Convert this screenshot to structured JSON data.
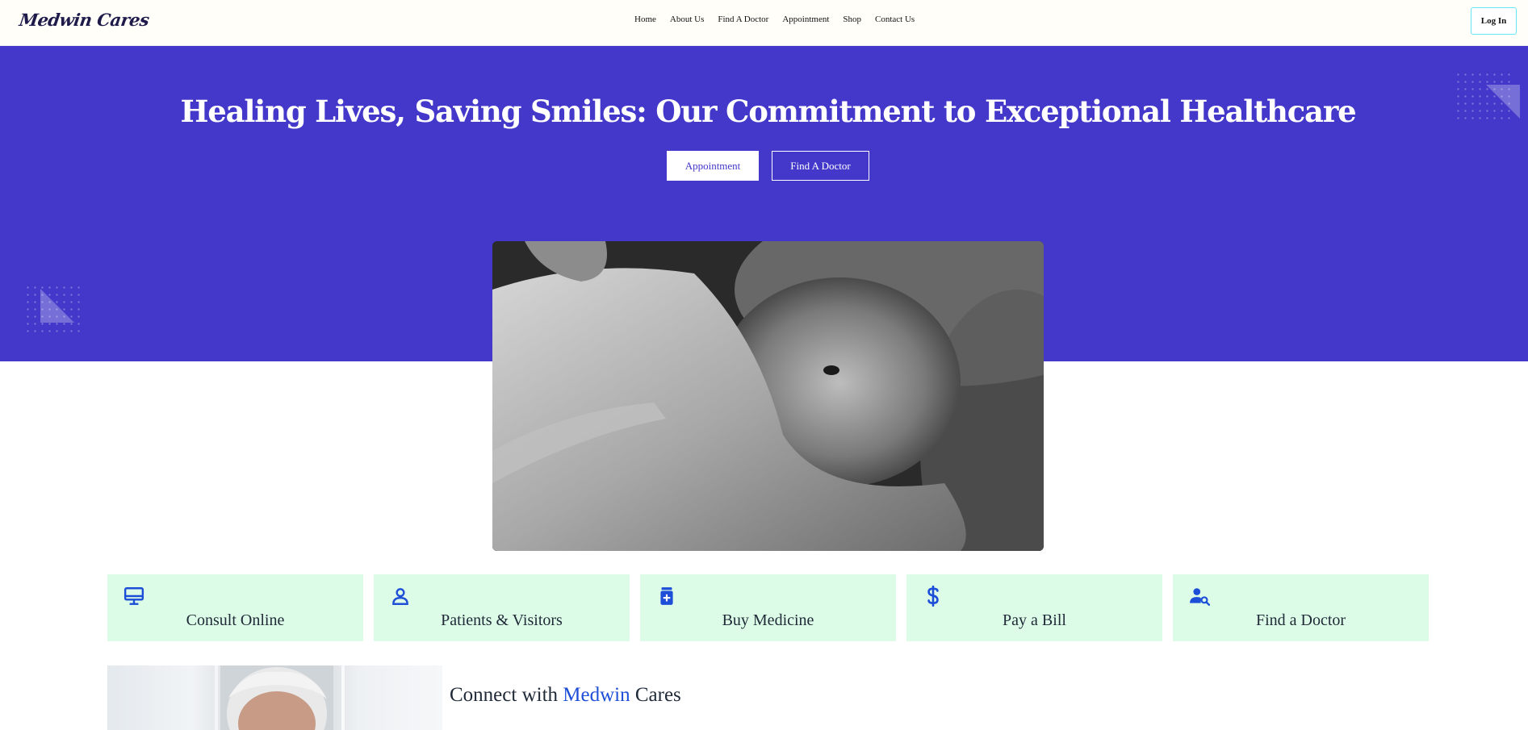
{
  "header": {
    "logo": "Medwin Cares",
    "nav": [
      "Home",
      "About Us",
      "Find A Doctor",
      "Appointment",
      "Shop",
      "Contact Us"
    ],
    "login_label": "Log In"
  },
  "hero": {
    "title": "Healing Lives, Saving Smiles: Our Commitment to Exceptional Healthcare",
    "appointment_label": "Appointment",
    "find_doctor_label": "Find A Doctor"
  },
  "services": [
    {
      "label": "Consult Online",
      "icon": "monitor-icon"
    },
    {
      "label": "Patients & Visitors",
      "icon": "user-icon"
    },
    {
      "label": "Buy Medicine",
      "icon": "medicine-bottle-icon"
    },
    {
      "label": "Pay a Bill",
      "icon": "dollar-icon"
    },
    {
      "label": "Find a Doctor",
      "icon": "user-search-icon"
    }
  ],
  "connect": {
    "prefix": "Connect with",
    "brand": "Medwin",
    "suffix": "Cares"
  },
  "colors": {
    "hero_bg": "#4338ca",
    "card_bg": "#dcfce7",
    "accent": "#1d4ed8"
  }
}
